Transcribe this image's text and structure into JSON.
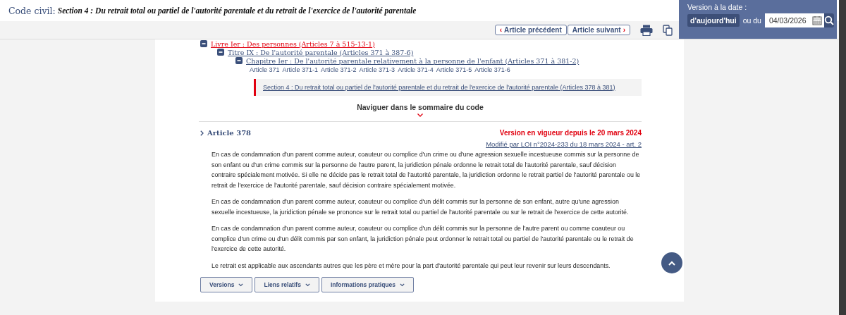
{
  "header": {
    "code": "Code civil:",
    "section": "Section 4 : Du retrait total ou partiel de l'autorité parentale et du retrait de l'exercice de l'autorité parentale"
  },
  "version_panel": {
    "label": "Version à la date :",
    "today_button": "d'aujourd'hui",
    "or_label": "ou du",
    "date": "04/03/2026"
  },
  "toolbar": {
    "buttons": [
      {
        "kind": "prev",
        "label": "Article précédent",
        "chevron": "‹"
      },
      {
        "kind": "next",
        "label": "Article suivant",
        "chevron": "›"
      }
    ]
  },
  "tree": [
    {
      "label": "Livre Ier : Des personnes (Articles 7 à 515-13-1)",
      "expanded": true,
      "children": [
        {
          "label": "Titre IX : De l'autorité parentale (Articles 371 à 387-6)",
          "expanded": true,
          "children": [
            {
              "label": "Chapitre Ier : De l'autorité parentale relativement à la personne de l'enfant (Articles 371 à 381-2)",
              "expanded": true,
              "articles": [
                "Article 371",
                "Article 371-1",
                "Article 371-2",
                "Article 371-3",
                "Article 371-4",
                "Article 371-5",
                "Article 371-6"
              ],
              "children": [
                {
                  "label": "Section 4 : Du retrait total ou partiel de l'autorité parentale et du retrait de l'exercice de l'autorité parentale (Articles 378 à 381)",
                  "selected": true
                }
              ]
            }
          ]
        }
      ]
    }
  ],
  "navigate": {
    "label": "Naviguer dans le sommaire du code"
  },
  "article": {
    "title": "Article 378",
    "status": "Version en vigueur depuis le 20 mars 2024",
    "modified": "Modifié par LOI n°2024-233 du 18 mars 2024 - art. 2",
    "paragraphs": [
      "En cas de condamnation d'un parent comme auteur, coauteur ou complice d'un crime ou d'une agression sexuelle incestueuse commis sur la personne de son enfant ou d'un crime commis sur la personne de l'autre parent, la juridiction pénale ordonne le retrait total de l'autorité parentale, sauf décision contraire spécialement motivée. Si elle ne décide pas le retrait total de l'autorité parentale, la juridiction ordonne le retrait partiel de l'autorité parentale ou le retrait de l'exercice de l'autorité parentale, sauf décision contraire spécialement motivée.",
      "En cas de condamnation d'un parent comme auteur, coauteur ou complice d'un délit commis sur la personne de son enfant, autre qu'une agression sexuelle incestueuse, la juridiction pénale se prononce sur le retrait total ou partiel de l'autorité parentale ou sur le retrait de l'exercice de cette autorité.",
      "En cas de condamnation d'un parent comme auteur, coauteur ou complice d'un délit commis sur la personne de l'autre parent ou comme coauteur ou complice d'un crime ou d'un délit commis par son enfant, la juridiction pénale peut ordonner le retrait total ou partiel de l'autorité parentale ou le retrait de l'exercice de cette autorité.",
      "Le retrait est applicable aux ascendants autres que les père et mère pour la part d'autorité parentale qui peut leur revenir sur leurs descendants."
    ]
  },
  "dropdowns": [
    "Versions",
    "Liens relatifs",
    "Informations pratiques"
  ]
}
